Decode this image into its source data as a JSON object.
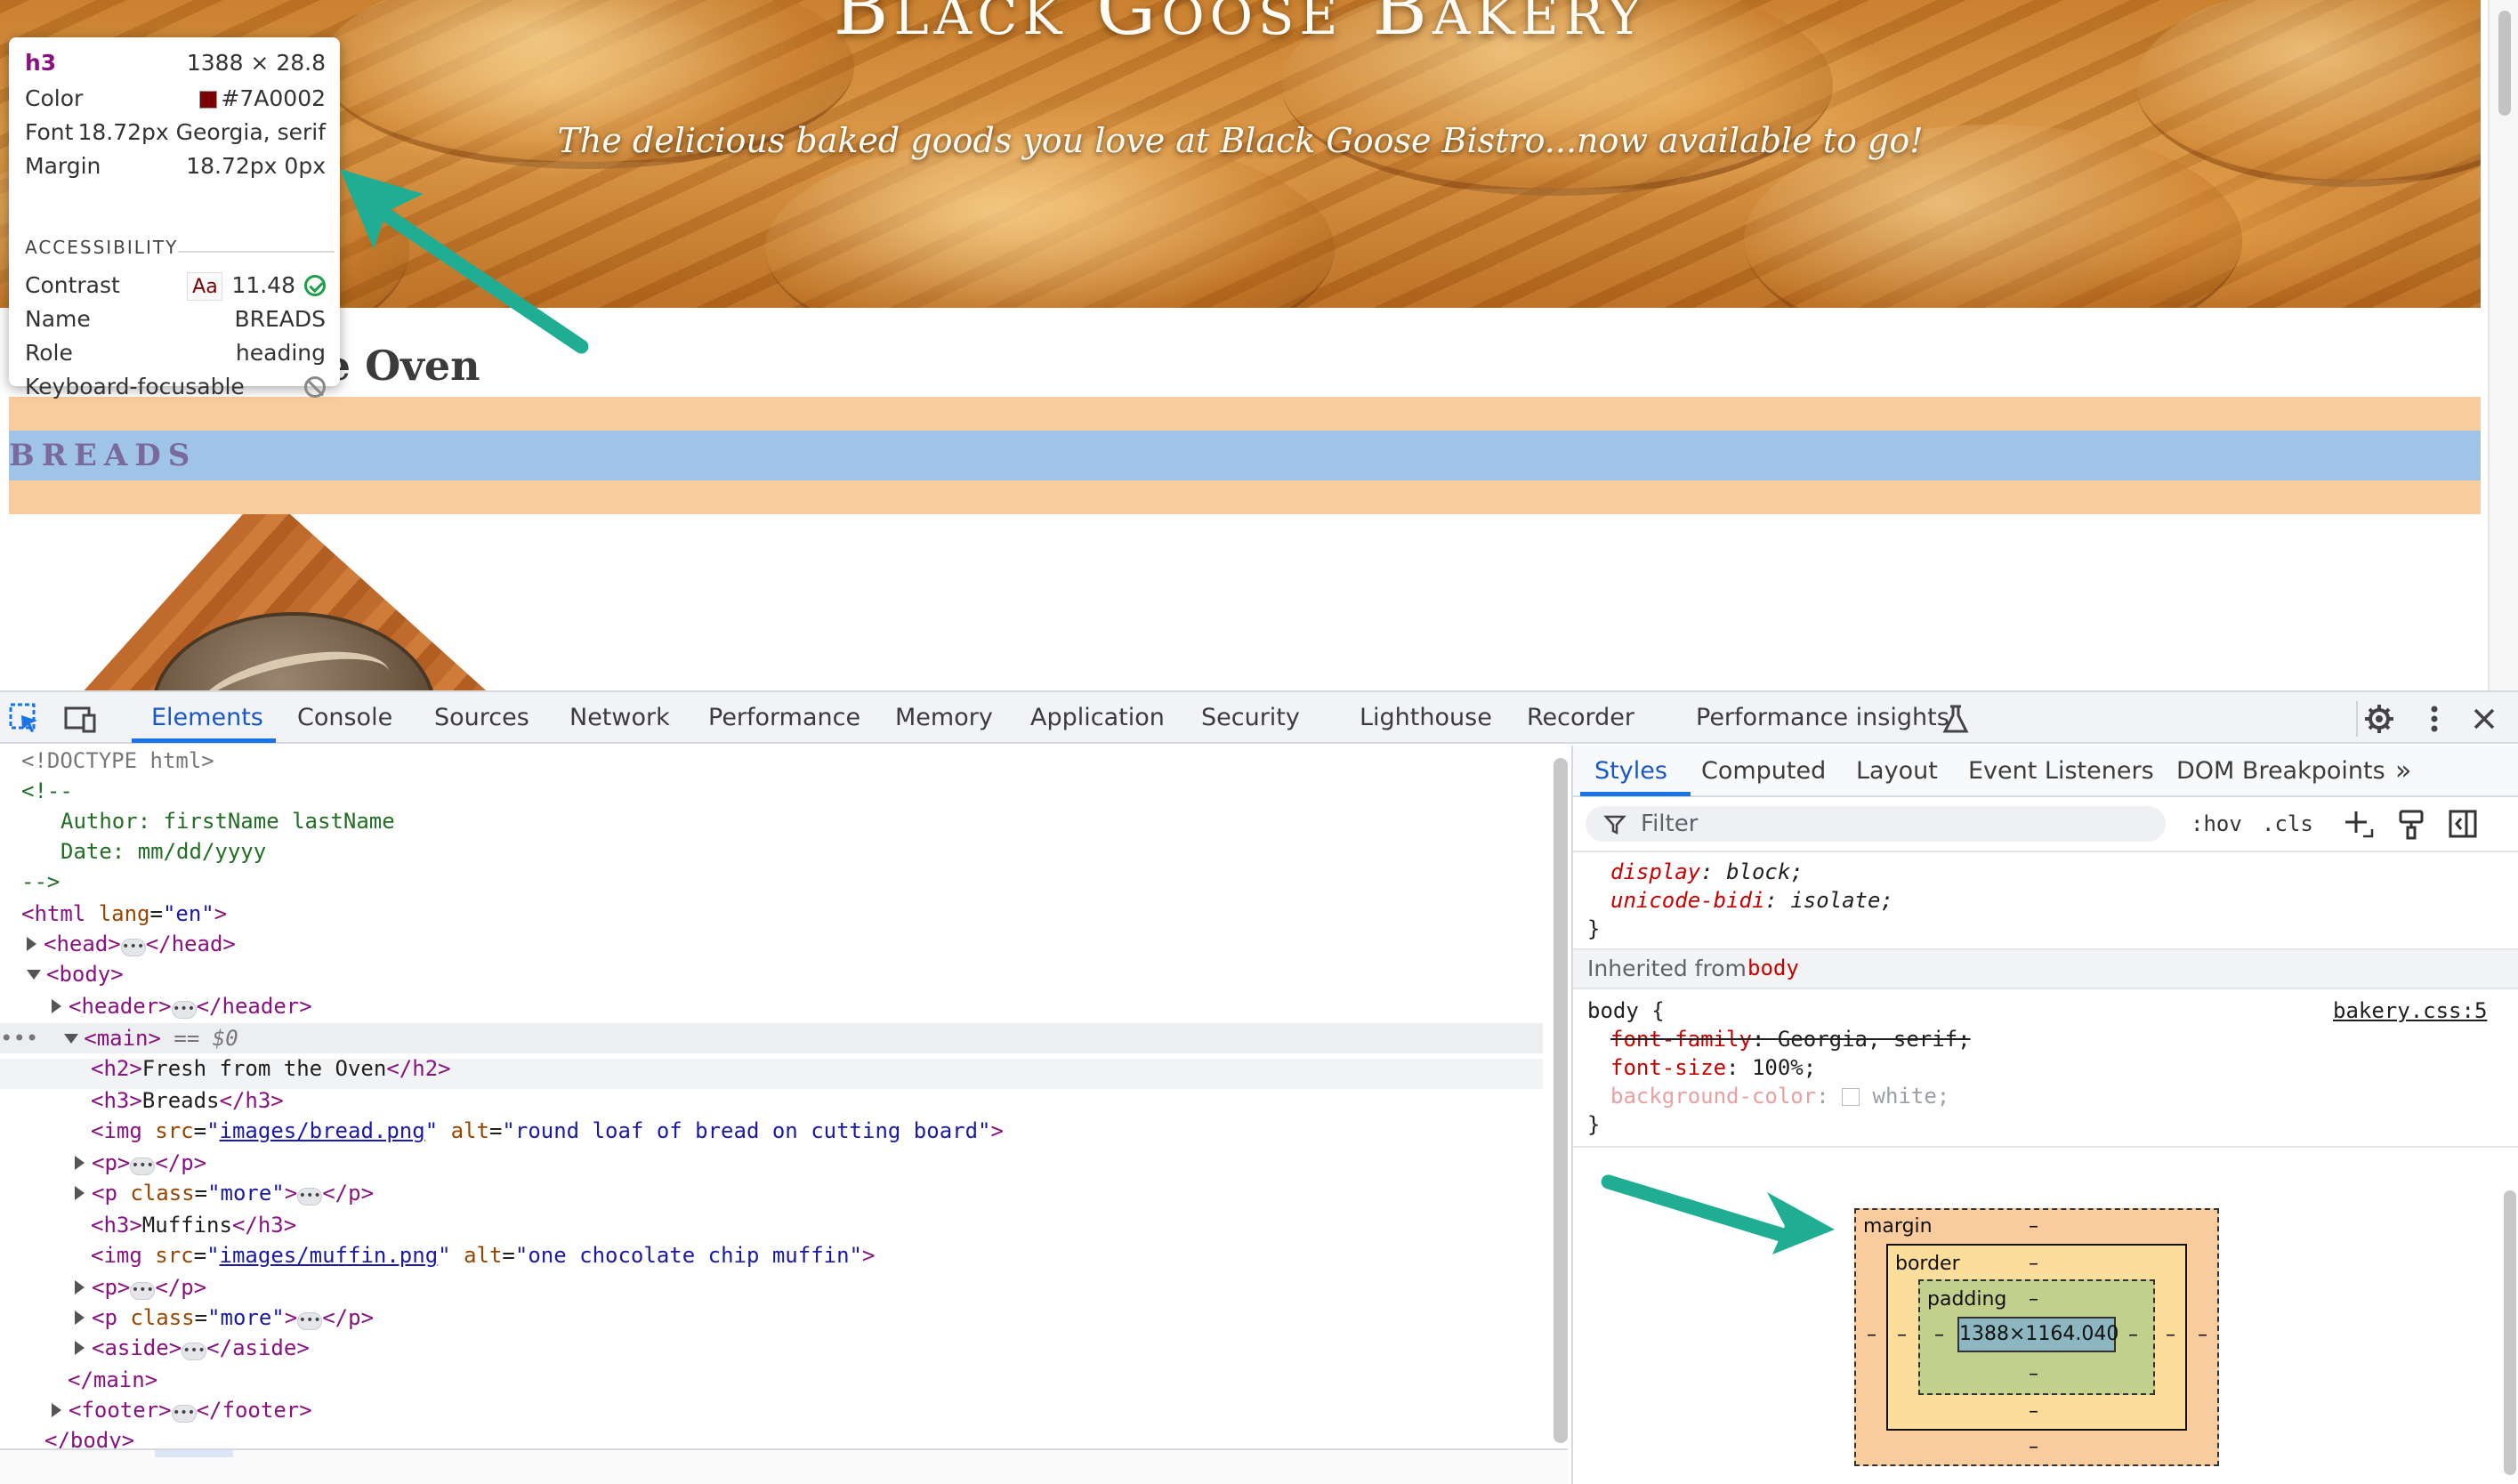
{
  "page": {
    "site_title": "Black Goose Bakery",
    "tagline": "The delicious baked goods you love at Black Goose Bistro...now available to go!",
    "h2": "Fresh from the Oven",
    "h3": "BREADS"
  },
  "tooltip": {
    "tag": "h3",
    "size": "1388 × 28.8",
    "rows": [
      {
        "label": "Color",
        "value": "#7A0002"
      },
      {
        "label": "Font",
        "value": "18.72px Georgia, serif"
      },
      {
        "label": "Margin",
        "value": "18.72px 0px"
      }
    ],
    "accessibility_heading": "ACCESSIBILITY",
    "a11y_rows": [
      {
        "label": "Contrast",
        "badge": "Aa",
        "value": "11.48"
      },
      {
        "label": "Name",
        "value": "BREADS"
      },
      {
        "label": "Role",
        "value": "heading"
      },
      {
        "label": "Keyboard-focusable",
        "value": ""
      }
    ],
    "colors": {
      "swatch": "#7a0002"
    }
  },
  "devtools": {
    "tabs": [
      "Elements",
      "Console",
      "Sources",
      "Network",
      "Performance",
      "Memory",
      "Application",
      "Security",
      "Lighthouse",
      "Recorder",
      "Performance insights"
    ],
    "active_tab": "Elements",
    "code": {
      "doctype": "<!DOCTYPE html>",
      "comment_open": "<!--",
      "comment_author": "Author: firstName lastName",
      "comment_date": "Date: mm/dd/yyyy",
      "comment_close": "-->",
      "html_tag": "html",
      "lang_attr": "lang",
      "lang_val": "\"en\"",
      "head": "head",
      "body": "body",
      "header": "header",
      "main": "main",
      "main_marker": "== $0",
      "h2_text": "Fresh from the Oven",
      "h3_text": "Breads",
      "img1_src": "images/bread.png",
      "img1_alt": "\"round loaf of bread on cutting board\"",
      "p": "p",
      "p_more_class": "\"more\"",
      "h3_muffins": "Muffins",
      "img2_src": "images/muffin.png",
      "img2_alt": "\"one chocolate chip muffin\"",
      "aside": "aside",
      "footer": "footer"
    },
    "styles": {
      "tabs": [
        "Styles",
        "Computed",
        "Layout",
        "Event Listeners",
        "DOM Breakpoints"
      ],
      "active_tab": "Styles",
      "filter_placeholder": "Filter",
      "hov": ":hov",
      "cls": ".cls",
      "ua_rule": [
        {
          "prop": "display",
          "value": "block;"
        },
        {
          "prop": "unicode-bidi",
          "value": "isolate;"
        }
      ],
      "inherited_label": "Inherited from",
      "inherited_from": "body",
      "body_selector": "body {",
      "source_link": "bakery.css:5",
      "body_rule": [
        {
          "prop": "font-family",
          "value": "Georgia, serif;"
        },
        {
          "prop": "font-size",
          "value": "100%;"
        },
        {
          "prop": "background-color",
          "value": "white;"
        }
      ]
    },
    "box_model": {
      "margin_label": "margin",
      "border_label": "border",
      "padding_label": "padding",
      "content_size": "1388×1164.040",
      "dash": "–"
    }
  }
}
